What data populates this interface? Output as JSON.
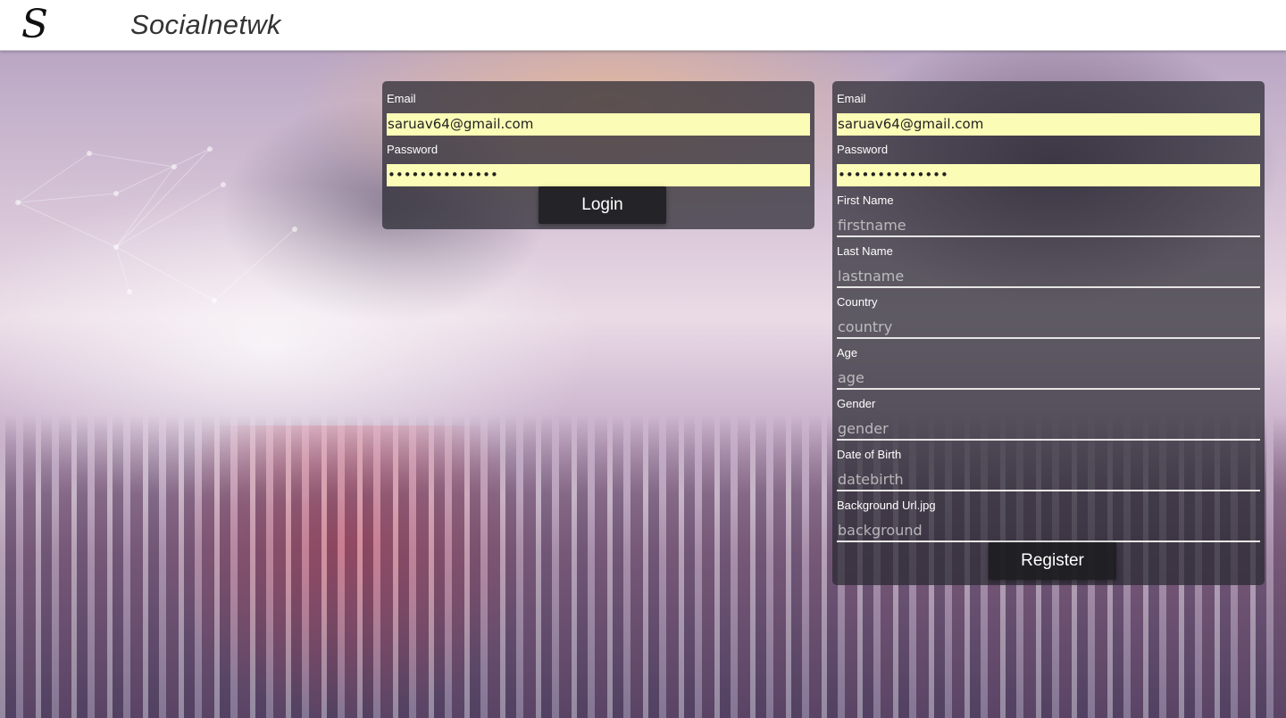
{
  "header": {
    "logo_text": "S",
    "brand": "Socialnetwk"
  },
  "login": {
    "email_label": "Email",
    "email_value": "saruav64@gmail.com",
    "password_label": "Password",
    "password_value": "••••••••••••••",
    "button_label": "Login"
  },
  "register": {
    "email_label": "Email",
    "email_value": "saruav64@gmail.com",
    "password_label": "Password",
    "password_value": "••••••••••••••",
    "fields": [
      {
        "label": "First Name",
        "placeholder": "firstname"
      },
      {
        "label": "Last Name",
        "placeholder": "lastname"
      },
      {
        "label": "Country",
        "placeholder": "country"
      },
      {
        "label": "Age",
        "placeholder": "age"
      },
      {
        "label": "Gender",
        "placeholder": "gender"
      },
      {
        "label": "Date of Birth",
        "placeholder": "datebirth"
      },
      {
        "label": "Background Url.jpg",
        "placeholder": "background"
      }
    ],
    "button_label": "Register"
  },
  "colors": {
    "autofill_yellow": "#fbfcb6",
    "panel": "rgba(40,40,48,0.72)"
  }
}
